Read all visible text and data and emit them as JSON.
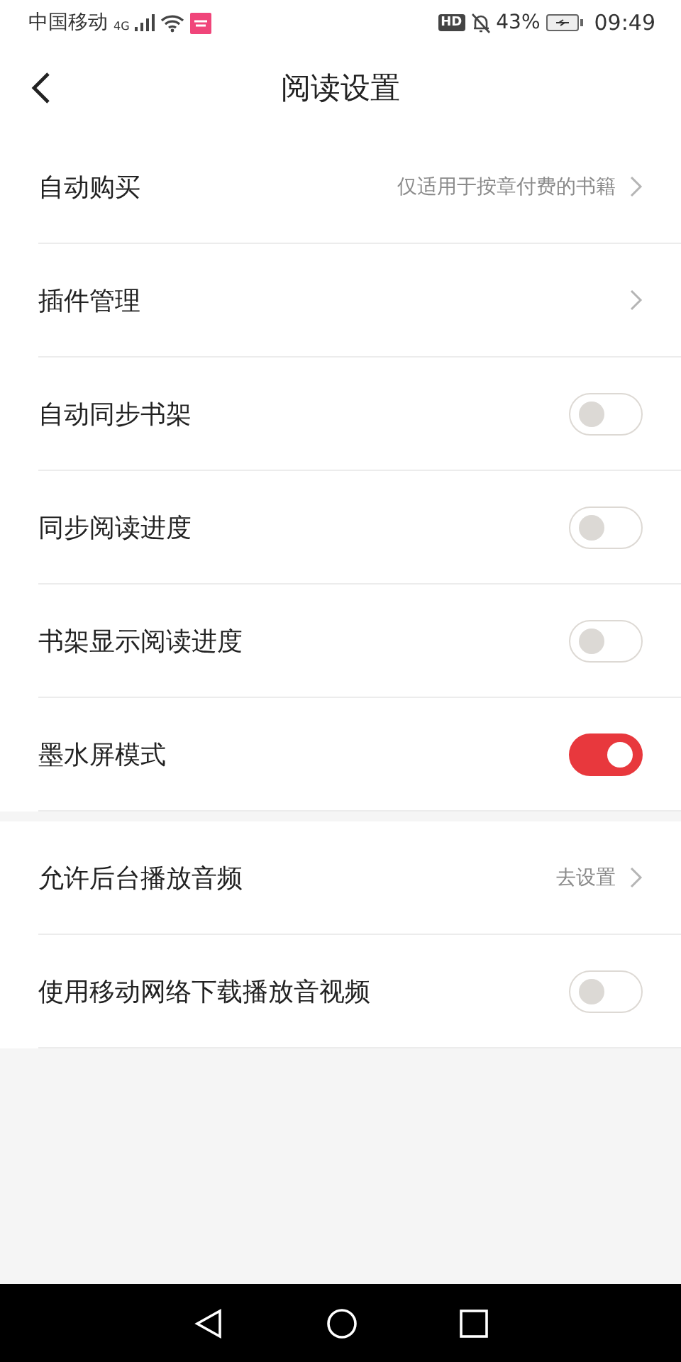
{
  "status_bar": {
    "carrier": "中国移动",
    "network": "4G",
    "hd": "HD",
    "battery": "43%",
    "time": "09:49"
  },
  "header": {
    "title": "阅读设置"
  },
  "sections": [
    {
      "items": [
        {
          "kind": "link",
          "label": "自动购买",
          "hint": "仅适用于按章付费的书籍"
        },
        {
          "kind": "link",
          "label": "插件管理"
        },
        {
          "kind": "switch",
          "label": "自动同步书架",
          "on": false
        },
        {
          "kind": "switch",
          "label": "同步阅读进度",
          "on": false
        },
        {
          "kind": "switch",
          "label": "书架显示阅读进度",
          "on": false
        },
        {
          "kind": "switch",
          "label": "墨水屏模式",
          "on": true
        }
      ]
    },
    {
      "items": [
        {
          "kind": "link",
          "label": "允许后台播放音频",
          "hint": "去设置"
        },
        {
          "kind": "switch",
          "label": "使用移动网络下载播放音视频",
          "on": false
        }
      ]
    }
  ]
}
